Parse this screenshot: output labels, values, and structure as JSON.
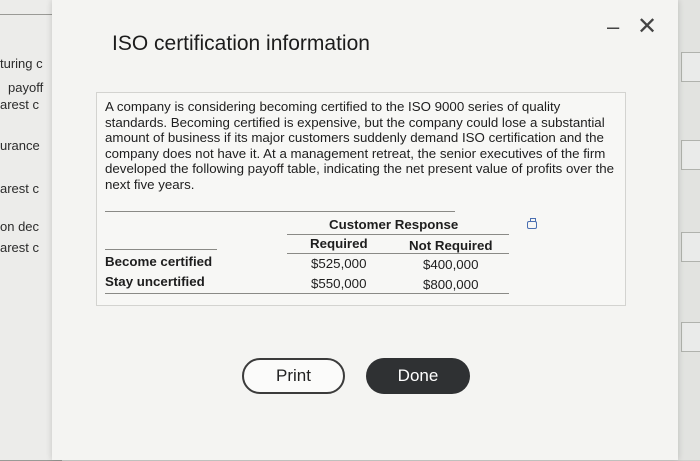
{
  "background": {
    "left_fragments": [
      "turing c",
      "payoff",
      "arest c",
      "urance",
      "arest c",
      "on dec",
      "arest c"
    ]
  },
  "dialog": {
    "title": "ISO certification information",
    "minimize_glyph": "–",
    "close_glyph": "✕",
    "description": "A company is considering becoming certified to the ISO 9000 series of quality standards. Becoming certified is expensive, but the company could lose a substantial amount of business if its major customers suddenly demand ISO certification and the company does not have it. At a management retreat, the senior executives of the firm developed the following payoff table, indicating the net present value of profits over the next five years.",
    "table": {
      "group_header": "Customer Response",
      "columns": [
        "Required",
        "Not Required"
      ],
      "rows": [
        {
          "label": "Become certified",
          "values": [
            "$525,000",
            "$400,000"
          ]
        },
        {
          "label": "Stay uncertified",
          "values": [
            "$550,000",
            "$800,000"
          ]
        }
      ]
    },
    "buttons": {
      "print": "Print",
      "done": "Done"
    }
  },
  "icons": {
    "copy": "copy-icon"
  },
  "colors": {
    "done_button": "#2f3133",
    "copy_icon": "#4a6fb1"
  }
}
